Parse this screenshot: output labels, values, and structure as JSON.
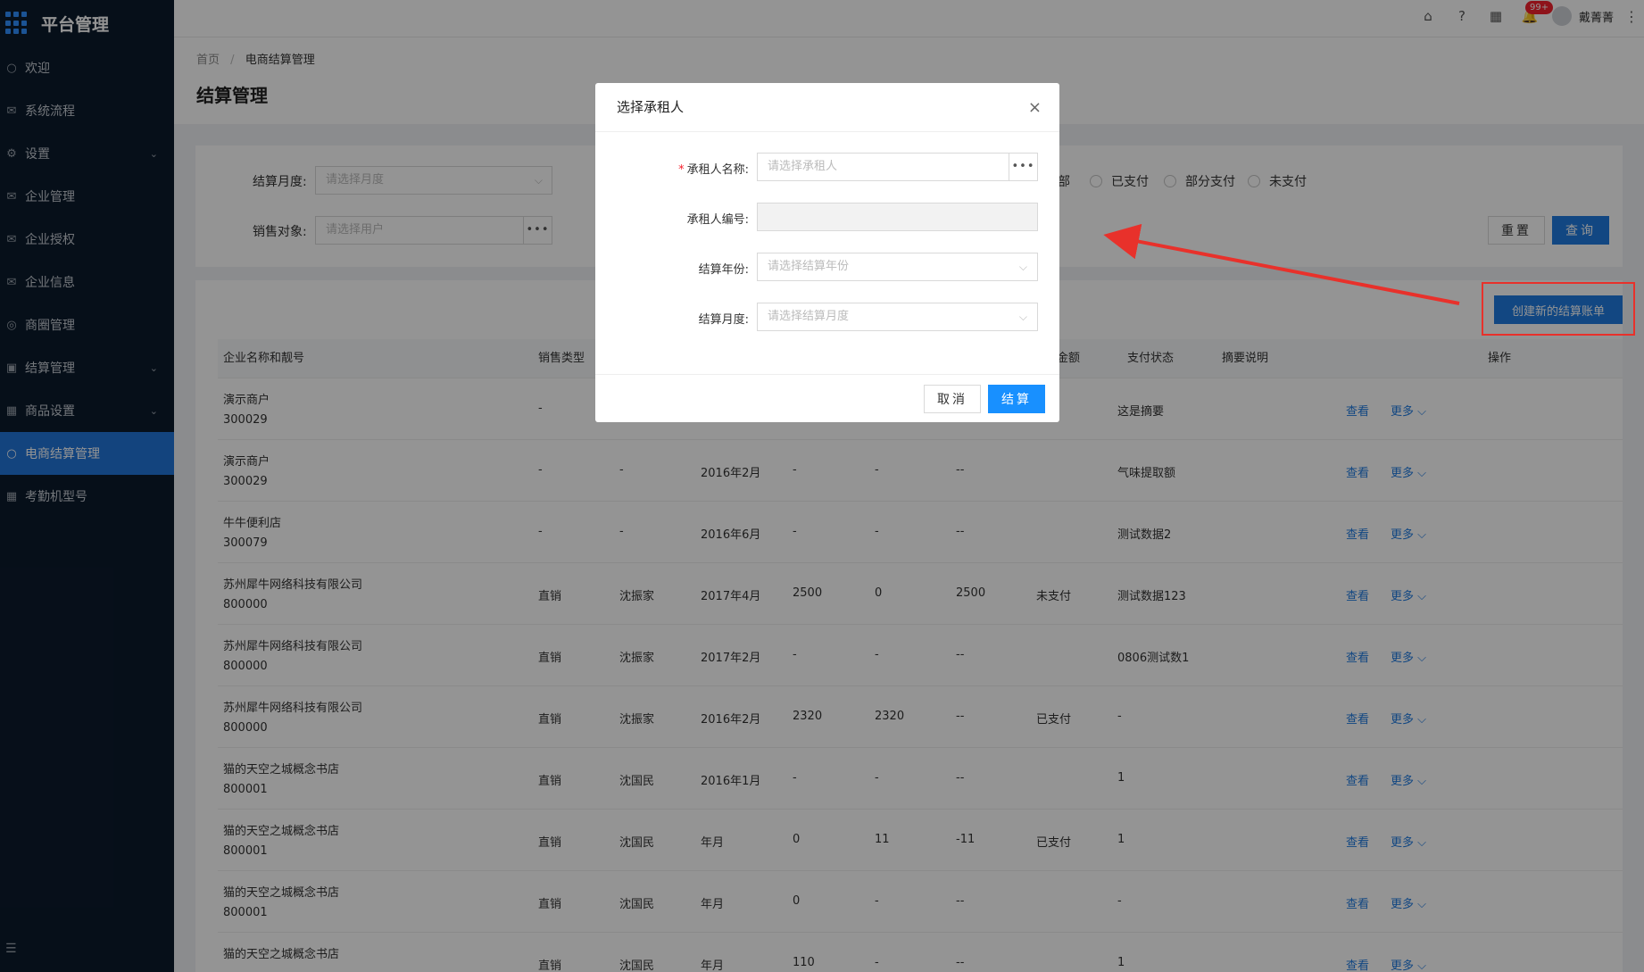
{
  "sidebar": {
    "title": "平台管理",
    "items": [
      {
        "label": "欢迎",
        "icon": "○",
        "chevron": ""
      },
      {
        "label": "系统流程",
        "icon": "✉",
        "chevron": ""
      },
      {
        "label": "设置",
        "icon": "⚙",
        "chevron": "⌄"
      },
      {
        "label": "企业管理",
        "icon": "✉",
        "chevron": ""
      },
      {
        "label": "企业授权",
        "icon": "✉",
        "chevron": ""
      },
      {
        "label": "企业信息",
        "icon": "✉",
        "chevron": ""
      },
      {
        "label": "商圈管理",
        "icon": "◎",
        "chevron": ""
      },
      {
        "label": "结算管理",
        "icon": "▣",
        "chevron": "⌄"
      },
      {
        "label": "商品设置",
        "icon": "▦",
        "chevron": "⌄"
      },
      {
        "label": "电商结算管理",
        "icon": "○",
        "chevron": ""
      },
      {
        "label": "考勤机型号",
        "icon": "▦",
        "chevron": ""
      }
    ],
    "collapse_icon": "☰"
  },
  "topbar": {
    "badge": "99+",
    "username": "戴菁菁",
    "icons": [
      "⌂",
      "?",
      "▦",
      "🔔"
    ],
    "more_icon": "⋮"
  },
  "breadcrumb": {
    "home": "首页",
    "sep": "/",
    "current": "电商结算管理"
  },
  "page_title": "结算管理",
  "filters": {
    "month_label": "结算月度:",
    "month_placeholder": "请选择月度",
    "target_label": "销售对象:",
    "target_placeholder": "请选择用户",
    "dots": "•••",
    "dropdown_arrow": "⌵",
    "radio_all": "部",
    "radio_paid": "已支付",
    "radio_partial": "部分支付",
    "radio_unpaid": "未支付",
    "reset": "重置",
    "query": "查询"
  },
  "create_button": "创建新的结算账单",
  "table": {
    "headers": [
      "企业名称和靓号",
      "销售类型",
      "",
      "",
      "",
      "",
      "金额",
      "支付状态",
      "摘要说明",
      "操作"
    ],
    "rows": [
      {
        "name": "演示商户",
        "code": "300029",
        "type": "-",
        "person": "",
        "month": "",
        "a": "",
        "b": "",
        "c": "",
        "status": "",
        "note": "这是摘要"
      },
      {
        "name": "演示商户",
        "code": "300029",
        "type": "-",
        "person": "-",
        "month": "2016年2月",
        "a": "-",
        "b": "-",
        "c": "--",
        "status": "",
        "note": "气味提取额"
      },
      {
        "name": "牛牛便利店",
        "code": "300079",
        "type": "-",
        "person": "-",
        "month": "2016年6月",
        "a": "-",
        "b": "-",
        "c": "--",
        "status": "",
        "note": "测试数据2"
      },
      {
        "name": "苏州犀牛网络科技有限公司",
        "code": "800000",
        "type": "直销",
        "person": "沈振家",
        "month": "2017年4月",
        "a": "2500",
        "b": "0",
        "c": "2500",
        "status": "未支付",
        "note": "测试数据123"
      },
      {
        "name": "苏州犀牛网络科技有限公司",
        "code": "800000",
        "type": "直销",
        "person": "沈振家",
        "month": "2017年2月",
        "a": "-",
        "b": "-",
        "c": "--",
        "status": "",
        "note": "0806测试数1"
      },
      {
        "name": "苏州犀牛网络科技有限公司",
        "code": "800000",
        "type": "直销",
        "person": "沈振家",
        "month": "2016年2月",
        "a": "2320",
        "b": "2320",
        "c": "--",
        "status": "已支付",
        "note": "-"
      },
      {
        "name": "猫的天空之城概念书店",
        "code": "800001",
        "type": "直销",
        "person": "沈国民",
        "month": "2016年1月",
        "a": "-",
        "b": "-",
        "c": "--",
        "status": "",
        "note": "1"
      },
      {
        "name": "猫的天空之城概念书店",
        "code": "800001",
        "type": "直销",
        "person": "沈国民",
        "month": "年月",
        "a": "0",
        "b": "11",
        "c": "-11",
        "status": "已支付",
        "note": "1"
      },
      {
        "name": "猫的天空之城概念书店",
        "code": "800001",
        "type": "直销",
        "person": "沈国民",
        "month": "年月",
        "a": "0",
        "b": "-",
        "c": "--",
        "status": "",
        "note": "-"
      },
      {
        "name": "猫的天空之城概念书店",
        "code": "",
        "type": "直销",
        "person": "沈国民",
        "month": "年月",
        "a": "110",
        "b": "-",
        "c": "--",
        "status": "",
        "note": "1"
      }
    ],
    "view": "查看",
    "more": "更多 ⌵"
  },
  "modal": {
    "title": "选择承租人",
    "close": "×",
    "name_label": "承租人名称:",
    "required_mark": "*",
    "name_placeholder": "请选择承租人",
    "code_label": "承租人编号:",
    "year_label": "结算年份:",
    "year_placeholder": "请选择结算年份",
    "month_label": "结算月度:",
    "month_placeholder": "请选择结算月度",
    "cancel": "取消",
    "ok": "结算"
  },
  "colors": {
    "accent": "#1f7ae0",
    "sidebar": "#0c1a2c",
    "annotation": "#e8312b"
  }
}
